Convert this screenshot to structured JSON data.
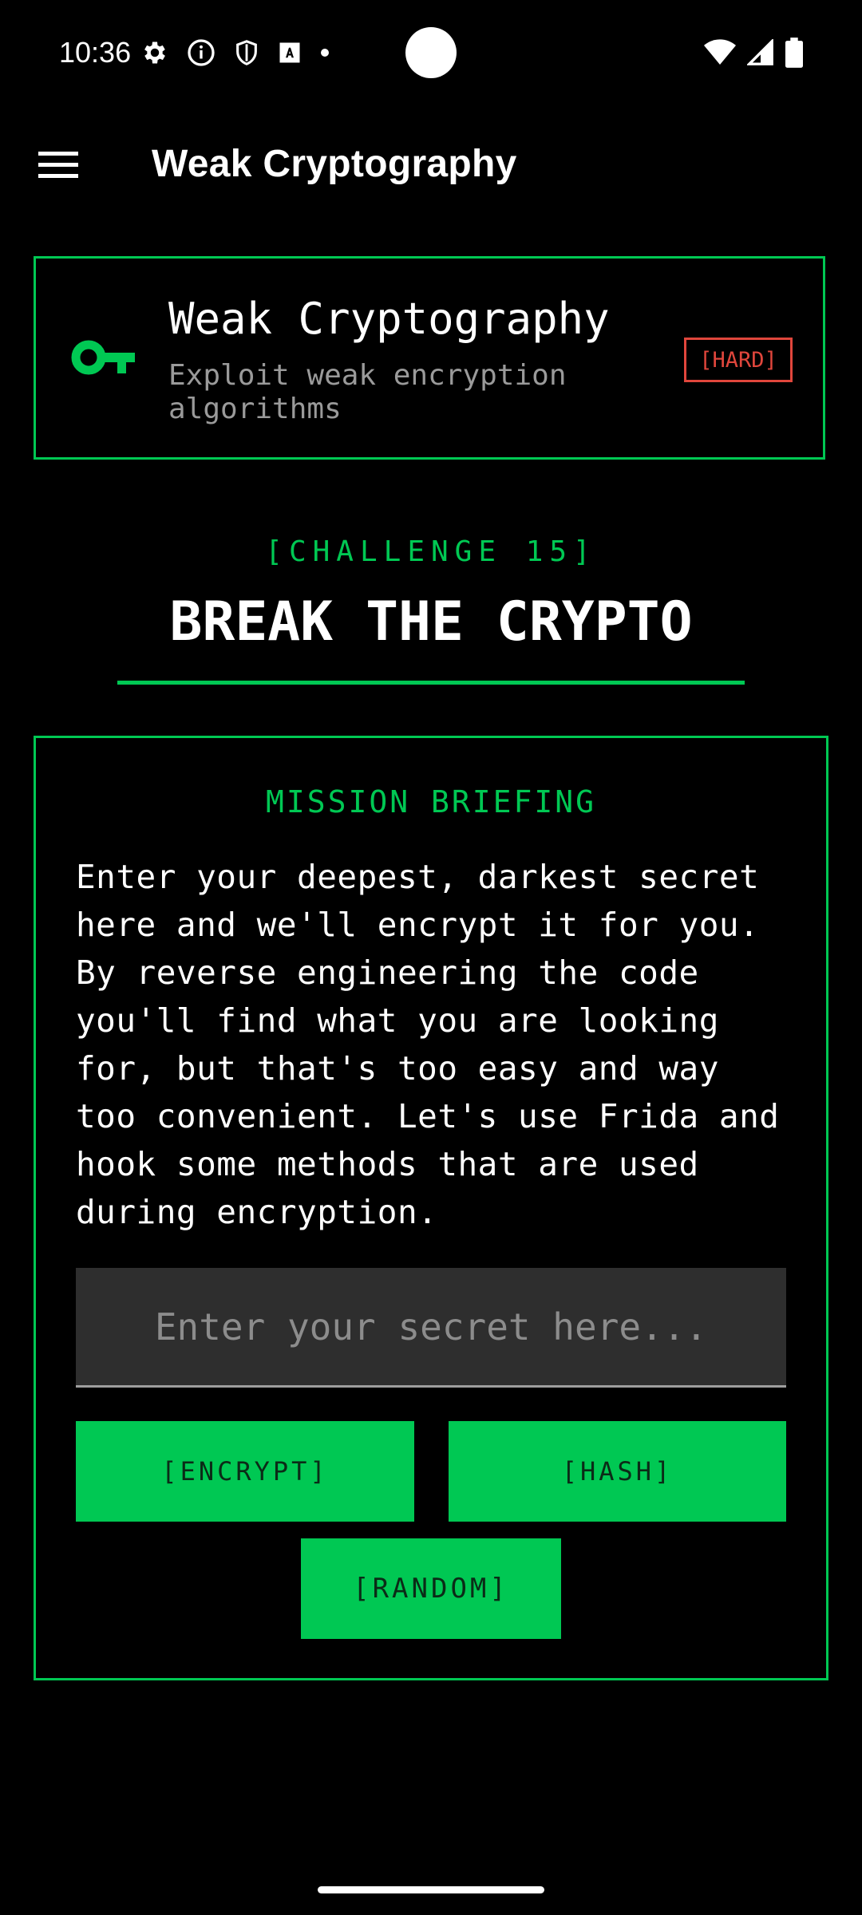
{
  "status_bar": {
    "time": "10:36",
    "left_icons": [
      "settings-icon",
      "info-icon",
      "shield-icon",
      "font-icon",
      "dot-icon"
    ],
    "right_icons": [
      "wifi-icon",
      "signal-icon",
      "battery-icon"
    ]
  },
  "app_bar": {
    "title": "Weak Cryptography",
    "menu_icon": "hamburger-menu-icon"
  },
  "header_card": {
    "icon": "key-icon",
    "title": "Weak Cryptography",
    "subtitle": "Exploit weak encryption algorithms",
    "difficulty": "[HARD]"
  },
  "challenge": {
    "label": "[CHALLENGE 15]",
    "title": "BREAK THE CRYPTO"
  },
  "mission": {
    "heading": "MISSION BRIEFING",
    "text": "Enter your deepest, darkest secret here and we'll encrypt it for you. By reverse engineering the code you'll find what you are looking for, but that's too easy and way too convenient. Let's use Frida and hook some methods that are used during encryption.",
    "input_placeholder": "Enter your secret here...",
    "input_value": "",
    "buttons": {
      "encrypt": "[ENCRYPT]",
      "hash": "[HASH]",
      "random": "[RANDOM]"
    }
  },
  "colors": {
    "accent": "#00c853",
    "danger": "#e0463c",
    "background": "#000000",
    "input_bg": "#2e2e2e"
  }
}
